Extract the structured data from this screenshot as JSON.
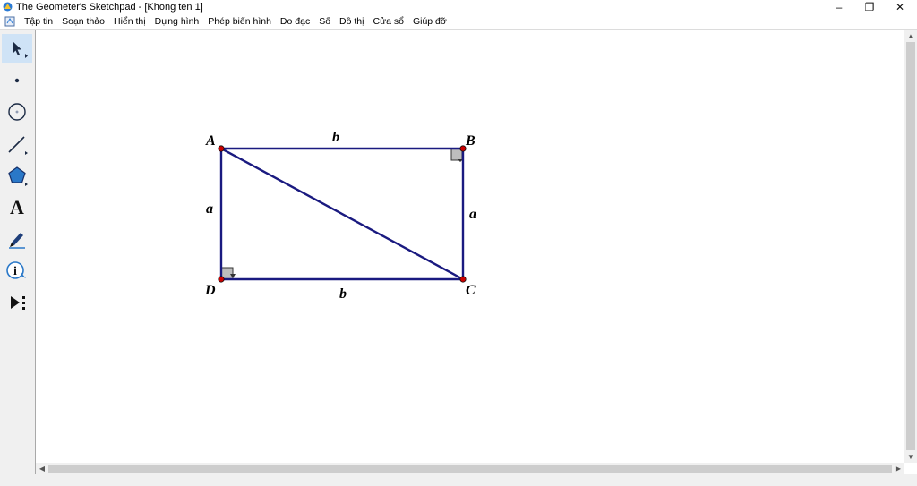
{
  "window": {
    "title": "The Geometer's Sketchpad - [Khong ten 1]",
    "minimize": "–",
    "restore": "❐",
    "close": "✕"
  },
  "menu": {
    "items": [
      "Tập tin",
      "Soạn thảo",
      "Hiển thị",
      "Dựng hình",
      "Phép biến hình",
      "Đo đạc",
      "Số",
      "Đồ thị",
      "Cửa sổ",
      "Giúp đỡ"
    ],
    "mdi_minimize": "–",
    "mdi_restore": "⧉",
    "mdi_close": "✕"
  },
  "toolbox": {
    "tools": [
      {
        "name": "arrow-select-tool",
        "icon": "arrow-icon",
        "selected": true
      },
      {
        "name": "point-tool",
        "icon": "point-icon"
      },
      {
        "name": "compass-tool",
        "icon": "circle-icon"
      },
      {
        "name": "straightedge-tool",
        "icon": "segment-icon"
      },
      {
        "name": "polygon-tool",
        "icon": "pentagon-icon"
      },
      {
        "name": "text-tool",
        "icon": "text-a-icon",
        "glyph": "A"
      },
      {
        "name": "marker-tool",
        "icon": "pen-icon"
      },
      {
        "name": "information-tool",
        "icon": "info-icon",
        "glyph": "i"
      },
      {
        "name": "custom-tool",
        "icon": "play-menu-icon"
      }
    ]
  },
  "sketch": {
    "colors": {
      "line": "#1a1a80",
      "point": "#cc0000",
      "right_angle_fill": "#bdbdbd"
    },
    "points": [
      {
        "id": "A",
        "label": "A"
      },
      {
        "id": "B",
        "label": "B"
      },
      {
        "id": "C",
        "label": "C"
      },
      {
        "id": "D",
        "label": "D"
      }
    ],
    "side_labels": {
      "top": "b",
      "bottom": "b",
      "left": "a",
      "right": "a"
    }
  },
  "scroll": {
    "left": "◀",
    "right": "▶",
    "up": "▲",
    "down": "▼"
  }
}
